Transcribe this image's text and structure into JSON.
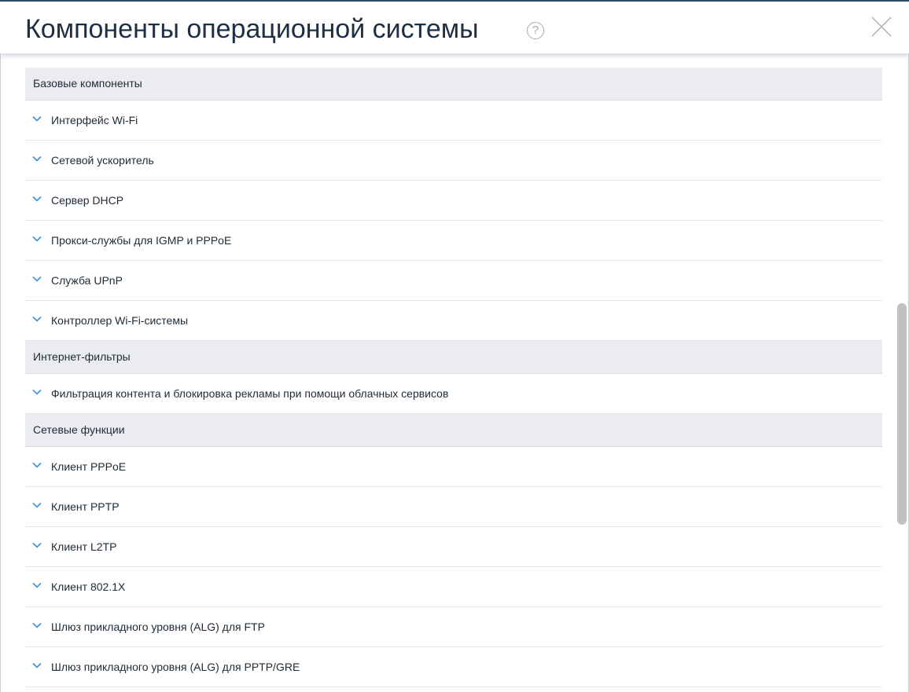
{
  "dialog": {
    "title": "Компоненты операционной системы",
    "help_glyph": "?",
    "close_icon": "close-icon",
    "help_icon": "question-circle-icon"
  },
  "colors": {
    "title": "#1e2f44",
    "group_bg": "#ebecef",
    "chevron": "#3b8fd9",
    "text": "#1e2a36"
  },
  "groups": [
    {
      "title": "Базовые компоненты",
      "items": [
        "Интерфейс Wi-Fi",
        "Сетевой ускоритель",
        "Сервер DHCP",
        "Прокси-службы для IGMP и PPPoE",
        "Служба UPnP",
        "Контроллер Wi-Fi-системы"
      ]
    },
    {
      "title": "Интернет-фильтры",
      "items": [
        "Фильтрация контента и блокировка рекламы при помощи облачных сервисов"
      ]
    },
    {
      "title": "Сетевые функции",
      "items": [
        "Клиент PPPoE",
        "Клиент PPTP",
        "Клиент L2TP",
        "Клиент 802.1X",
        "Шлюз прикладного уровня (ALG) для FTP",
        "Шлюз прикладного уровня (ALG) для PPTP/GRE"
      ]
    }
  ]
}
